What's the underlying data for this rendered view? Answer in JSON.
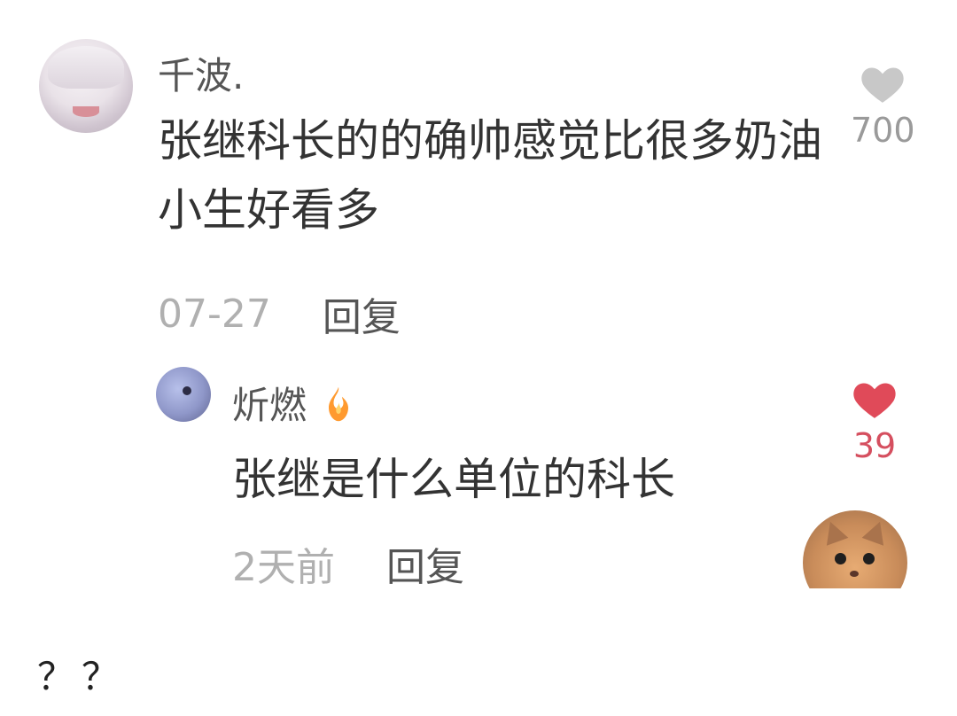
{
  "comment": {
    "username": "千波.",
    "text": "张继科长的的确帅感觉比很多奶油小生好看多",
    "time": "07-27",
    "reply_label": "回复",
    "likes": "700",
    "heart_color": "#c8c8c8"
  },
  "reply": {
    "username": "炘燃",
    "username_icon": "fire-icon",
    "text": "张继是什么单位的科长",
    "time": "2天前",
    "reply_label": "回复",
    "likes": "39",
    "heart_color": "#e04a59"
  },
  "caption": "？？"
}
